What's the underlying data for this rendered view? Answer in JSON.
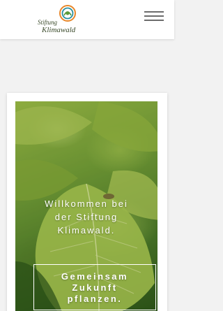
{
  "header": {
    "logo_line_1": "Stiftung",
    "logo_line_2": "Klimawald",
    "menu_icon": "hamburger-menu-icon"
  },
  "hero": {
    "title_lines": [
      "Willkommen bei",
      "der Stiftung",
      "Klimawald."
    ],
    "cta_lines": [
      "Gemeinsam",
      "Zukunft",
      "pflanzen."
    ]
  },
  "colors": {
    "logo_orange": "#e8872a",
    "logo_teal": "#2a8fa0",
    "logo_green": "#5a9a3a",
    "text_dark": "#3a4a2a"
  }
}
